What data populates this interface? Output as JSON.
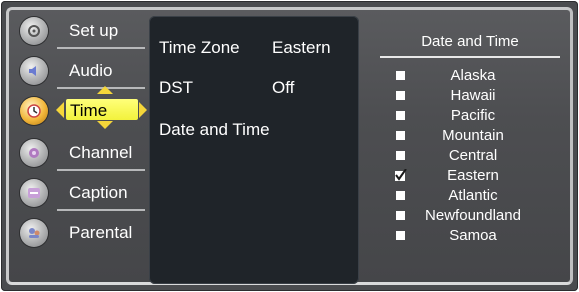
{
  "sidebar": {
    "items": [
      {
        "label": "Set up",
        "icon": "settings-icon"
      },
      {
        "label": "Audio",
        "icon": "audio-icon"
      },
      {
        "label": "Time",
        "icon": "clock-icon"
      },
      {
        "label": "Channel",
        "icon": "channel-icon"
      },
      {
        "label": "Caption",
        "icon": "caption-icon"
      },
      {
        "label": "Parental",
        "icon": "parental-icon"
      }
    ],
    "selected_index": 2
  },
  "settings": {
    "time_zone": {
      "name": "Time Zone",
      "value": "Eastern"
    },
    "dst": {
      "name": "DST",
      "value": "Off"
    },
    "date_time": {
      "name": "Date and Time"
    }
  },
  "options": {
    "title": "Date and Time",
    "items": [
      {
        "label": "Alaska",
        "checked": false
      },
      {
        "label": "Hawaii",
        "checked": false
      },
      {
        "label": "Pacific",
        "checked": false
      },
      {
        "label": "Mountain",
        "checked": false
      },
      {
        "label": "Central",
        "checked": false
      },
      {
        "label": "Eastern",
        "checked": true
      },
      {
        "label": "Atlantic",
        "checked": false
      },
      {
        "label": "Newfoundland",
        "checked": false
      },
      {
        "label": "Samoa",
        "checked": false
      }
    ]
  },
  "colors": {
    "highlight": "#f2f23c",
    "arrow": "#f5d63a",
    "panel": "#1f2429",
    "frame": "#4a4c4f"
  }
}
